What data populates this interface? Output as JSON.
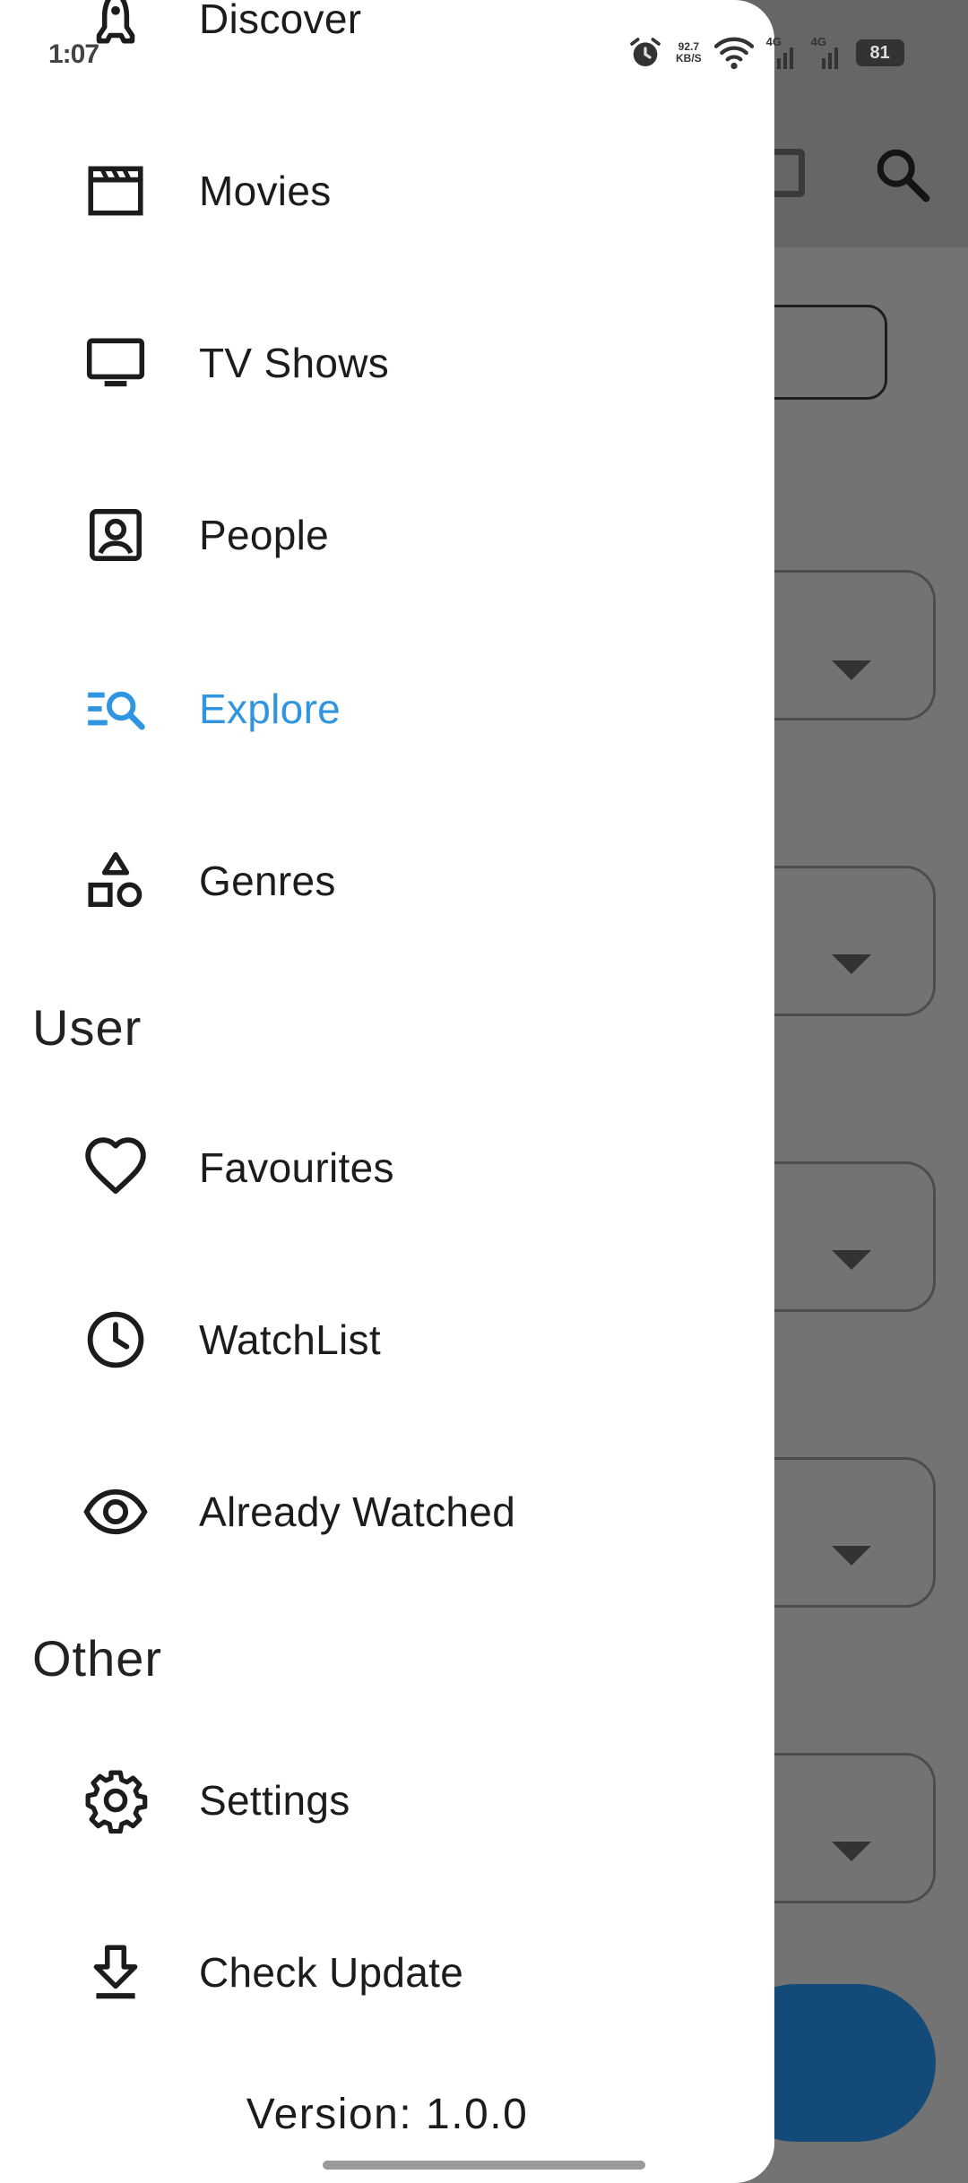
{
  "status_bar": {
    "time": "1:07",
    "network_speed_value": "92.7",
    "network_speed_unit": "KB/S",
    "signal_1": "4G",
    "signal_2": "4G",
    "battery": "81"
  },
  "drawer": {
    "items_top": [
      {
        "label": "Discover",
        "icon": "rocket-icon"
      },
      {
        "label": "Movies",
        "icon": "clapperboard-icon"
      },
      {
        "label": "TV Shows",
        "icon": "tv-icon"
      },
      {
        "label": "People",
        "icon": "person-card-icon"
      },
      {
        "label": "Explore",
        "icon": "manage-search-icon",
        "active": true
      },
      {
        "label": "Genres",
        "icon": "shapes-icon"
      }
    ],
    "section_user": "User",
    "items_user": [
      {
        "label": "Favourites",
        "icon": "heart-icon"
      },
      {
        "label": "WatchList",
        "icon": "clock-icon"
      },
      {
        "label": "Already Watched",
        "icon": "eye-icon"
      }
    ],
    "section_other": "Other",
    "items_other": [
      {
        "label": "Settings",
        "icon": "gear-icon"
      },
      {
        "label": "Check Update",
        "icon": "download-icon"
      }
    ],
    "version": "Version: 1.0.0"
  },
  "colors": {
    "accent": "#2f95e0",
    "drawer_bg": "#ffffff",
    "scrim": "#737373",
    "fab": "#134a78"
  }
}
